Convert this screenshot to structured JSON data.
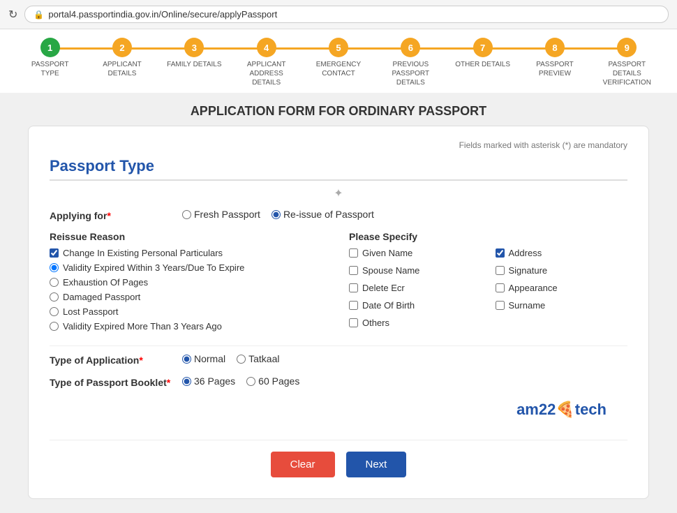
{
  "browser": {
    "url": "portal4.passportindia.gov.in/Online/secure/applyPassport"
  },
  "steps": [
    {
      "number": "1",
      "label": "PASSPORT TYPE",
      "state": "completed"
    },
    {
      "number": "2",
      "label": "APPLICANT DETAILS",
      "state": "active"
    },
    {
      "number": "3",
      "label": "FAMILY DETAILS",
      "state": "active"
    },
    {
      "number": "4",
      "label": "APPLICANT ADDRESS DETAILS",
      "state": "active"
    },
    {
      "number": "5",
      "label": "EMERGENCY CONTACT",
      "state": "active"
    },
    {
      "number": "6",
      "label": "PREVIOUS PASSPORT DETAILS",
      "state": "active"
    },
    {
      "number": "7",
      "label": "OTHER DETAILS",
      "state": "active"
    },
    {
      "number": "8",
      "label": "PASSPORT PREVIEW",
      "state": "active"
    },
    {
      "number": "9",
      "label": "PASSPORT DETAILS VERIFICATION",
      "state": "active"
    }
  ],
  "page": {
    "title": "APPLICATION FORM FOR ORDINARY PASSPORT"
  },
  "form": {
    "mandatory_note": "Fields marked with asterisk (*) are mandatory",
    "section_title": "Passport Type",
    "applying_for_label": "Applying for",
    "applying_for_options": [
      {
        "value": "fresh",
        "label": "Fresh Passport",
        "checked": false
      },
      {
        "value": "reissue",
        "label": "Re-issue of Passport",
        "checked": true
      }
    ],
    "reissue_reason": {
      "title": "Reissue Reason",
      "options": [
        {
          "label": "Change In Existing Personal Particulars",
          "checked": true,
          "type": "checkbox"
        },
        {
          "label": "Validity Expired Within 3 Years/Due To Expire",
          "checked": true,
          "type": "radio"
        },
        {
          "label": "Exhaustion Of Pages",
          "checked": false,
          "type": "radio"
        },
        {
          "label": "Damaged Passport",
          "checked": false,
          "type": "radio"
        },
        {
          "label": "Lost Passport",
          "checked": false,
          "type": "radio"
        },
        {
          "label": "Validity Expired More Than 3 Years Ago",
          "checked": false,
          "type": "radio"
        }
      ]
    },
    "please_specify": {
      "title": "Please Specify",
      "options": [
        {
          "label": "Given Name",
          "checked": false
        },
        {
          "label": "Address",
          "checked": true
        },
        {
          "label": "Spouse Name",
          "checked": false
        },
        {
          "label": "Signature",
          "checked": false
        },
        {
          "label": "Delete Ecr",
          "checked": false
        },
        {
          "label": "Appearance",
          "checked": false
        },
        {
          "label": "Date Of Birth",
          "checked": false
        },
        {
          "label": "Surname",
          "checked": false
        },
        {
          "label": "Others",
          "checked": false
        }
      ]
    },
    "type_of_application": {
      "label": "Type of Application",
      "options": [
        {
          "value": "normal",
          "label": "Normal",
          "checked": true
        },
        {
          "value": "tatkaal",
          "label": "Tatkaal",
          "checked": false
        }
      ]
    },
    "type_of_booklet": {
      "label": "Type of Passport Booklet",
      "options": [
        {
          "value": "36",
          "label": "36 Pages",
          "checked": true
        },
        {
          "value": "60",
          "label": "60 Pages",
          "checked": false
        }
      ]
    },
    "buttons": {
      "clear": "Clear",
      "next": "Next"
    }
  },
  "branding": {
    "text": "am22tech",
    "emoji": "🍕"
  }
}
